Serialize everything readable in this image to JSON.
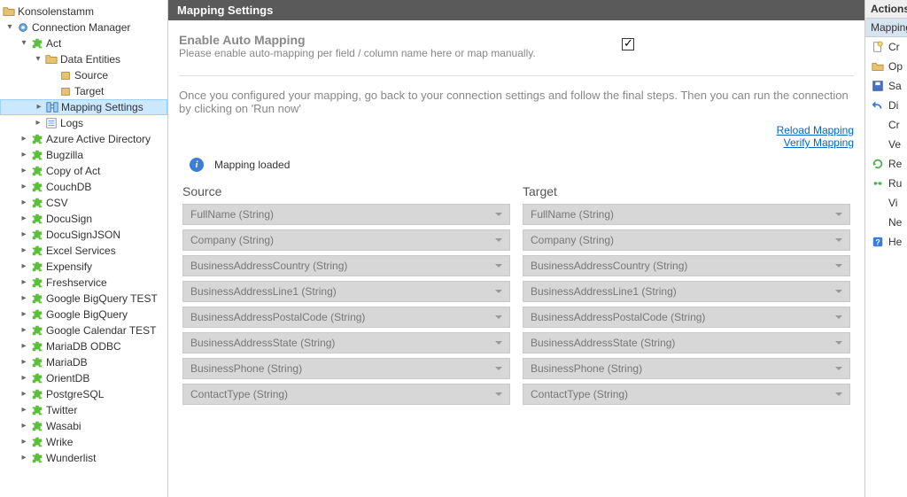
{
  "tree": {
    "root": "Konsolenstamm",
    "connection_manager": "Connection Manager",
    "act": "Act",
    "data_entities": "Data Entities",
    "source": "Source",
    "target": "Target",
    "mapping_settings": "Mapping Settings",
    "logs": "Logs",
    "nodes": [
      "Azure Active Directory",
      "Bugzilla",
      "Copy of Act",
      "CouchDB",
      "CSV",
      "DocuSign",
      "DocuSignJSON",
      "Excel Services",
      "Expensify",
      "Freshservice",
      "Google BigQuery TEST",
      "Google BigQuery",
      "Google Calendar TEST",
      "MariaDB ODBC",
      "MariaDB",
      "OrientDB",
      "PostgreSQL",
      "Twitter",
      "Wasabi",
      "Wrike",
      "Wunderlist"
    ]
  },
  "header": {
    "title": "Mapping Settings"
  },
  "enable": {
    "heading": "Enable Auto Mapping",
    "sub": "Please enable auto-mapping per field / column name here or map manually.",
    "checked": true
  },
  "help": "Once you configured your mapping, go back to your connection settings and follow the final steps. Then you can run the connection by clicking on 'Run now'",
  "links": {
    "reload": "Reload Mapping",
    "verify": "Verify Mapping"
  },
  "status": {
    "message": "Mapping loaded"
  },
  "mapping": {
    "source_header": "Source",
    "target_header": "Target",
    "rows": [
      {
        "source": "FullName (String)",
        "target": "FullName (String)"
      },
      {
        "source": "Company (String)",
        "target": "Company (String)"
      },
      {
        "source": "BusinessAddressCountry (String)",
        "target": "BusinessAddressCountry (String)"
      },
      {
        "source": "BusinessAddressLine1 (String)",
        "target": "BusinessAddressLine1 (String)"
      },
      {
        "source": "BusinessAddressPostalCode (String)",
        "target": "BusinessAddressPostalCode (String)"
      },
      {
        "source": "BusinessAddressState (String)",
        "target": "BusinessAddressState (String)"
      },
      {
        "source": "BusinessPhone (String)",
        "target": "BusinessPhone (String)"
      },
      {
        "source": "ContactType (String)",
        "target": "ContactType (String)"
      }
    ]
  },
  "actions": {
    "header": "Actions",
    "sub": "Mapping",
    "items": [
      {
        "label": "Cr",
        "icon": "new"
      },
      {
        "label": "Op",
        "icon": "open"
      },
      {
        "label": "Sa",
        "icon": "save"
      },
      {
        "label": "Di",
        "icon": "undo"
      },
      {
        "label": "Cr",
        "icon": "none"
      },
      {
        "label": "Ve",
        "icon": "none"
      },
      {
        "label": "Re",
        "icon": "refresh"
      },
      {
        "label": "Ru",
        "icon": "run"
      },
      {
        "label": "Vi",
        "icon": "none"
      },
      {
        "label": "Ne",
        "icon": "none"
      },
      {
        "label": "He",
        "icon": "help"
      }
    ]
  }
}
